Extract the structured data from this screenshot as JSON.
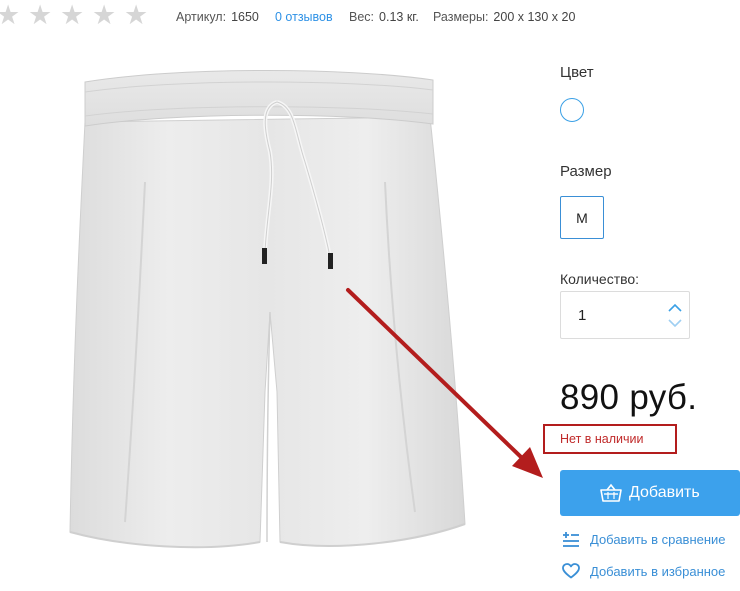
{
  "rating": {
    "stars_filled": 0,
    "stars_total": 5
  },
  "meta": {
    "article_label": "Артикул:",
    "article_value": "1650",
    "reviews_link": "0 отзывов",
    "weight_label": "Вес:",
    "weight_value": "0.13 кг.",
    "dimensions_label": "Размеры:",
    "dimensions_value": "200 x 130 x 20"
  },
  "options": {
    "color_label": "Цвет",
    "color_swatch": "#ffffff",
    "size_label": "Размер",
    "size_value": "M"
  },
  "quantity": {
    "label": "Количество:",
    "value": "1"
  },
  "price": "890 руб.",
  "stock_status": "Нет в наличии",
  "actions": {
    "add_to_cart": "Добавить",
    "compare": "Добавить в сравнение",
    "favorite": "Добавить в избранное"
  },
  "colors": {
    "accent": "#3ca1ec",
    "link": "#3a8fd6",
    "annotation_red": "#b31d1d"
  },
  "icons": {
    "star": "star-icon",
    "basket": "basket-icon",
    "compare": "compare-list-icon",
    "favorite": "heart-icon",
    "up": "chevron-up-icon",
    "down": "chevron-down-icon"
  }
}
